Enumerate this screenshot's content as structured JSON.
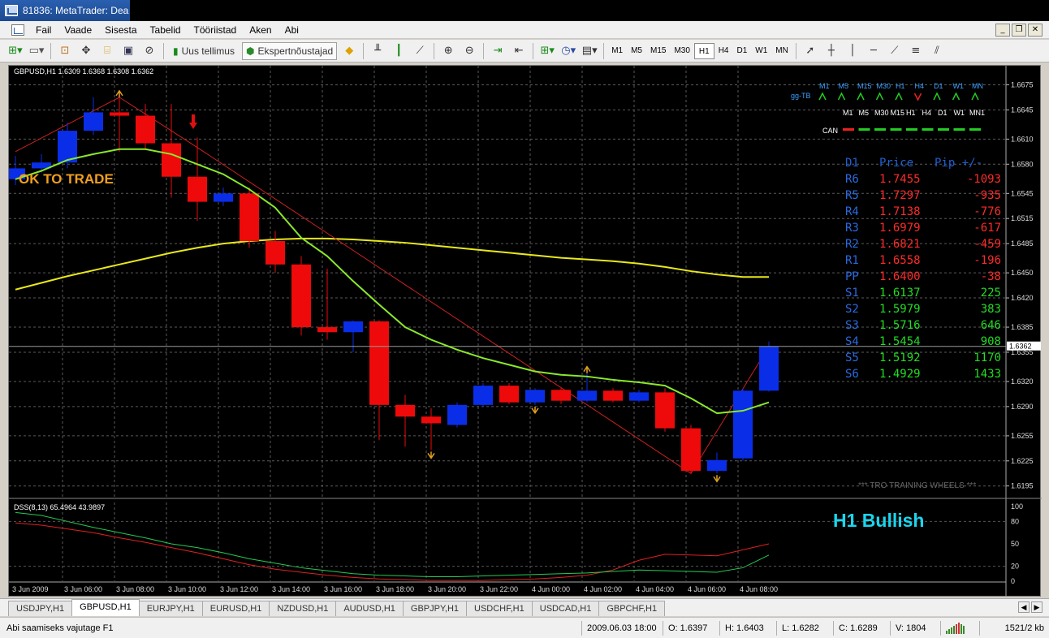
{
  "window": {
    "title": "81836: MetaTrader: Dea"
  },
  "menu": {
    "items": [
      {
        "label": "Fail"
      },
      {
        "label": "Vaade"
      },
      {
        "label": "Sisesta"
      },
      {
        "label": "Tabelid"
      },
      {
        "label": "Tööriistad"
      },
      {
        "label": "Aken"
      },
      {
        "label": "Abi"
      }
    ]
  },
  "toolbar": {
    "new_order": "Uus tellimus",
    "experts": "Ekspertnõustajad",
    "timeframes": [
      "M1",
      "M5",
      "M15",
      "M30",
      "H1",
      "H4",
      "D1",
      "W1",
      "MN"
    ],
    "active_timeframe": "H1"
  },
  "chart": {
    "header": "GBPUSD,H1  1.6309 1.6368 1.6308 1.6362",
    "ok_text": "OK TO TRADE",
    "price_ticks": [
      "1.6675",
      "1.6645",
      "1.6610",
      "1.6580",
      "1.6545",
      "1.6515",
      "1.6485",
      "1.6450",
      "1.6420",
      "1.6385",
      "1.6355",
      "1.6320",
      "1.6290",
      "1.6255",
      "1.6225",
      "1.6195"
    ],
    "current_price": "1.6362",
    "time_ticks": [
      "3 Jun 2009",
      "3 Jun 06:00",
      "3 Jun 08:00",
      "3 Jun 10:00",
      "3 Jun 12:00",
      "3 Jun 14:00",
      "3 Jun 16:00",
      "3 Jun 18:00",
      "3 Jun 20:00",
      "3 Jun 22:00",
      "4 Jun 00:00",
      "4 Jun 02:00",
      "4 Jun 04:00",
      "4 Jun 06:00",
      "4 Jun 08:00"
    ],
    "watermark": "*** TRO TRAINING WHEELS ***",
    "bullish_label": "H1 Bullish",
    "gg_tb": {
      "label": "gg-TB",
      "tfs": [
        "M1",
        "M5",
        "M15",
        "M30",
        "H1",
        "H4",
        "D1",
        "W1",
        "MN"
      ],
      "arrow_dirs": [
        "up",
        "up",
        "up",
        "up",
        "up",
        "down",
        "up",
        "up",
        "up"
      ]
    },
    "can": {
      "label": "CAN",
      "tfs": [
        "M1",
        "M5",
        "M30",
        "M15",
        "H1",
        "H4",
        "D1",
        "W1",
        "MN1"
      ]
    },
    "pivot_header": {
      "period": "D1",
      "price": "Price",
      "pip": "Pip +/-"
    },
    "pivots": [
      {
        "name": "R6",
        "price": "1.7455",
        "pip": "-1093",
        "color": "#ff2a2a"
      },
      {
        "name": "R5",
        "price": "1.7297",
        "pip": "-935",
        "color": "#ff2a2a"
      },
      {
        "name": "R4",
        "price": "1.7138",
        "pip": "-776",
        "color": "#ff2a2a"
      },
      {
        "name": "R3",
        "price": "1.6979",
        "pip": "-617",
        "color": "#ff2a2a"
      },
      {
        "name": "R2",
        "price": "1.6821",
        "pip": "-459",
        "color": "#ff2a2a"
      },
      {
        "name": "R1",
        "price": "1.6558",
        "pip": "-196",
        "color": "#ff2a2a"
      },
      {
        "name": "PP",
        "price": "1.6400",
        "pip": "-38",
        "color": "#ff2a2a"
      },
      {
        "name": "S1",
        "price": "1.6137",
        "pip": "225",
        "color": "#22dd22"
      },
      {
        "name": "S2",
        "price": "1.5979",
        "pip": "383",
        "color": "#22dd22"
      },
      {
        "name": "S3",
        "price": "1.5716",
        "pip": "646",
        "color": "#22dd22"
      },
      {
        "name": "S4",
        "price": "1.5454",
        "pip": "908",
        "color": "#22dd22"
      },
      {
        "name": "S5",
        "price": "1.5192",
        "pip": "1170",
        "color": "#22dd22"
      },
      {
        "name": "S6",
        "price": "1.4929",
        "pip": "1433",
        "color": "#22dd22"
      }
    ],
    "indicator": {
      "header": "DSS(8,13) 65.4964 43.9897",
      "ticks": [
        "100",
        "80",
        "50",
        "20",
        "0"
      ]
    }
  },
  "chart_data": {
    "type": "candlestick",
    "symbol": "GBPUSD",
    "timeframe": "H1",
    "ylim": [
      1.6185,
      1.669
    ],
    "candles": [
      {
        "o": 1.6562,
        "c": 1.6575,
        "h": 1.659,
        "l": 1.6555
      },
      {
        "o": 1.6575,
        "c": 1.6582,
        "h": 1.6592,
        "l": 1.657
      },
      {
        "o": 1.6582,
        "c": 1.662,
        "h": 1.663,
        "l": 1.6575
      },
      {
        "o": 1.662,
        "c": 1.6642,
        "h": 1.666,
        "l": 1.6615
      },
      {
        "o": 1.6642,
        "c": 1.6638,
        "h": 1.666,
        "l": 1.6595
      },
      {
        "o": 1.6638,
        "c": 1.6605,
        "h": 1.6652,
        "l": 1.6598
      },
      {
        "o": 1.6605,
        "c": 1.6565,
        "h": 1.6652,
        "l": 1.654
      },
      {
        "o": 1.6565,
        "c": 1.6535,
        "h": 1.6612,
        "l": 1.6512
      },
      {
        "o": 1.6535,
        "c": 1.6545,
        "h": 1.6552,
        "l": 1.653
      },
      {
        "o": 1.6545,
        "c": 1.6488,
        "h": 1.6552,
        "l": 1.648
      },
      {
        "o": 1.6488,
        "c": 1.646,
        "h": 1.65,
        "l": 1.645
      },
      {
        "o": 1.646,
        "c": 1.6385,
        "h": 1.647,
        "l": 1.6375
      },
      {
        "o": 1.6385,
        "c": 1.6379,
        "h": 1.6455,
        "l": 1.637
      },
      {
        "o": 1.6379,
        "c": 1.6392,
        "h": 1.6393,
        "l": 1.6355
      },
      {
        "o": 1.6392,
        "c": 1.6292,
        "h": 1.6393,
        "l": 1.625
      },
      {
        "o": 1.6292,
        "c": 1.6278,
        "h": 1.6304,
        "l": 1.6242
      },
      {
        "o": 1.6278,
        "c": 1.627,
        "h": 1.6288,
        "l": 1.6238
      },
      {
        "o": 1.6268,
        "c": 1.6292,
        "h": 1.6295,
        "l": 1.6265
      },
      {
        "o": 1.6292,
        "c": 1.6315,
        "h": 1.6318,
        "l": 1.629
      },
      {
        "o": 1.6315,
        "c": 1.6295,
        "h": 1.6318,
        "l": 1.6293
      },
      {
        "o": 1.6295,
        "c": 1.631,
        "h": 1.6312,
        "l": 1.6292
      },
      {
        "o": 1.631,
        "c": 1.6297,
        "h": 1.6312,
        "l": 1.6293
      },
      {
        "o": 1.6297,
        "c": 1.6309,
        "h": 1.633,
        "l": 1.6295
      },
      {
        "o": 1.6309,
        "c": 1.6297,
        "h": 1.6312,
        "l": 1.6295
      },
      {
        "o": 1.6297,
        "c": 1.6307,
        "h": 1.631,
        "l": 1.6295
      },
      {
        "o": 1.6307,
        "c": 1.6264,
        "h": 1.6312,
        "l": 1.626
      },
      {
        "o": 1.6264,
        "c": 1.6213,
        "h": 1.6268,
        "l": 1.621
      },
      {
        "o": 1.6213,
        "c": 1.6226,
        "h": 1.6235,
        "l": 1.621
      },
      {
        "o": 1.6228,
        "c": 1.6309,
        "h": 1.6312,
        "l": 1.6225
      },
      {
        "o": 1.6309,
        "c": 1.6362,
        "h": 1.6368,
        "l": 1.6308
      }
    ],
    "ma_green": [
      1.6562,
      1.6572,
      1.6585,
      1.6592,
      1.6598,
      1.6598,
      1.6592,
      1.658,
      1.6568,
      1.655,
      1.6528,
      1.6492,
      1.647,
      1.644,
      1.6412,
      1.6385,
      1.637,
      1.6358,
      1.6348,
      1.634,
      1.6332,
      1.6328,
      1.6326,
      1.6322,
      1.6319,
      1.6315,
      1.63,
      1.6282,
      1.6285,
      1.6295
    ],
    "ma_yellow": [
      1.643,
      1.6438,
      1.6446,
      1.6453,
      1.646,
      1.6467,
      1.6474,
      1.648,
      1.6485,
      1.6488,
      1.649,
      1.6491,
      1.6491,
      1.649,
      1.6488,
      1.6486,
      1.6483,
      1.648,
      1.6477,
      1.6474,
      1.6471,
      1.6468,
      1.6466,
      1.6464,
      1.6461,
      1.6457,
      1.6452,
      1.6448,
      1.6445,
      1.6445
    ],
    "zigzag": [
      [
        0,
        1.6595
      ],
      [
        4,
        1.666
      ],
      [
        7,
        1.66
      ],
      [
        26,
        1.621
      ],
      [
        29,
        1.6362
      ]
    ],
    "dss_red": [
      78,
      75,
      70,
      65,
      58,
      52,
      45,
      38,
      30,
      22,
      16,
      12,
      8,
      5,
      3,
      2,
      1,
      1,
      1,
      2,
      3,
      5,
      8,
      15,
      28,
      36,
      35,
      34,
      42,
      50
    ],
    "dss_green": [
      92,
      88,
      80,
      72,
      65,
      58,
      50,
      45,
      38,
      30,
      24,
      18,
      14,
      10,
      8,
      7,
      6,
      6,
      7,
      8,
      9,
      10,
      11,
      13,
      15,
      14,
      13,
      12,
      18,
      35
    ]
  },
  "tabs": [
    {
      "label": "USDJPY,H1"
    },
    {
      "label": "GBPUSD,H1"
    },
    {
      "label": "EURJPY,H1"
    },
    {
      "label": "EURUSD,H1"
    },
    {
      "label": "NZDUSD,H1"
    },
    {
      "label": "AUDUSD,H1"
    },
    {
      "label": "GBPJPY,H1"
    },
    {
      "label": "USDCHF,H1"
    },
    {
      "label": "USDCAD,H1"
    },
    {
      "label": "GBPCHF,H1"
    }
  ],
  "status": {
    "hint": "Abi saamiseks vajutage F1",
    "datetime": "2009.06.03 18:00",
    "open": "O: 1.6397",
    "high": "H: 1.6403",
    "low": "L: 1.6282",
    "close": "C: 1.6289",
    "volume": "V: 1804",
    "traffic": "1521/2 kb"
  }
}
